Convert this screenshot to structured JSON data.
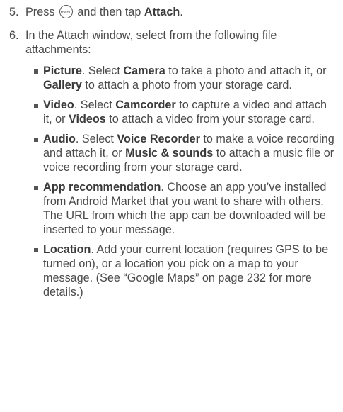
{
  "step5": {
    "number": "5.",
    "pre": "Press",
    "icon": "menu-key-icon",
    "mid": "and then tap",
    "action": "Attach",
    "end": "."
  },
  "step6": {
    "number": "6.",
    "text": "In the Attach window, select from the following file attachments:"
  },
  "items": [
    {
      "term": "Picture",
      "s1": ". Select ",
      "b1": "Camera",
      "s2": " to take a photo and attach it, or ",
      "b2": "Gallery",
      "s3": " to attach a photo from your storage card."
    },
    {
      "term": "Video",
      "s1": ". Select ",
      "b1": "Camcorder",
      "s2": " to capture a video and attach it, or ",
      "b2": "Videos",
      "s3": " to attach a video from your storage card."
    },
    {
      "term": "Audio",
      "s1": ". Select ",
      "b1": "Voice Recorder",
      "s2": " to make a voice recording and attach it, or ",
      "b2": "Music & sounds",
      "s3": " to attach a music file or voice recording from your storage card."
    },
    {
      "term": "App recommendation",
      "s1": ". Choose an app you’ve installed from Android Market that you want to share with others. The URL from which the app can be downloaded will be inserted to your message."
    },
    {
      "term": "Location",
      "s1": ". Add your current location (requires GPS to be turned on), or a location you pick on a map to your message. (See “Google Maps” on page 232 for more details.)"
    }
  ]
}
